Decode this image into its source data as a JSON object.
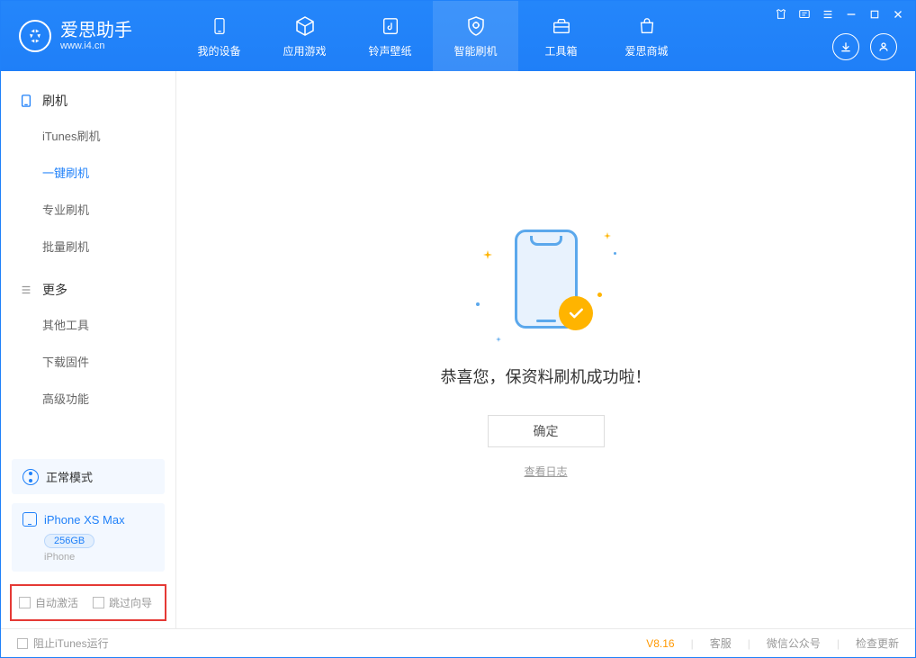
{
  "app": {
    "name": "爱思助手",
    "url": "www.i4.cn"
  },
  "nav": {
    "device": "我的设备",
    "apps": "应用游戏",
    "ring": "铃声壁纸",
    "flash": "智能刷机",
    "tools": "工具箱",
    "store": "爱思商城"
  },
  "sidebar": {
    "group_flash": "刷机",
    "items_flash": {
      "itunes": "iTunes刷机",
      "onekey": "一键刷机",
      "pro": "专业刷机",
      "batch": "批量刷机"
    },
    "group_more": "更多",
    "items_more": {
      "other": "其他工具",
      "download": "下载固件",
      "advanced": "高级功能"
    }
  },
  "device_panel": {
    "mode": "正常模式",
    "name": "iPhone XS Max",
    "storage": "256GB",
    "type": "iPhone"
  },
  "options": {
    "auto_activate": "自动激活",
    "skip_guide": "跳过向导"
  },
  "main": {
    "success_msg": "恭喜您，保资料刷机成功啦！",
    "ok": "确定",
    "view_log": "查看日志"
  },
  "footer": {
    "block_itunes": "阻止iTunes运行",
    "version": "V8.16",
    "support": "客服",
    "wechat": "微信公众号",
    "update": "检查更新"
  }
}
